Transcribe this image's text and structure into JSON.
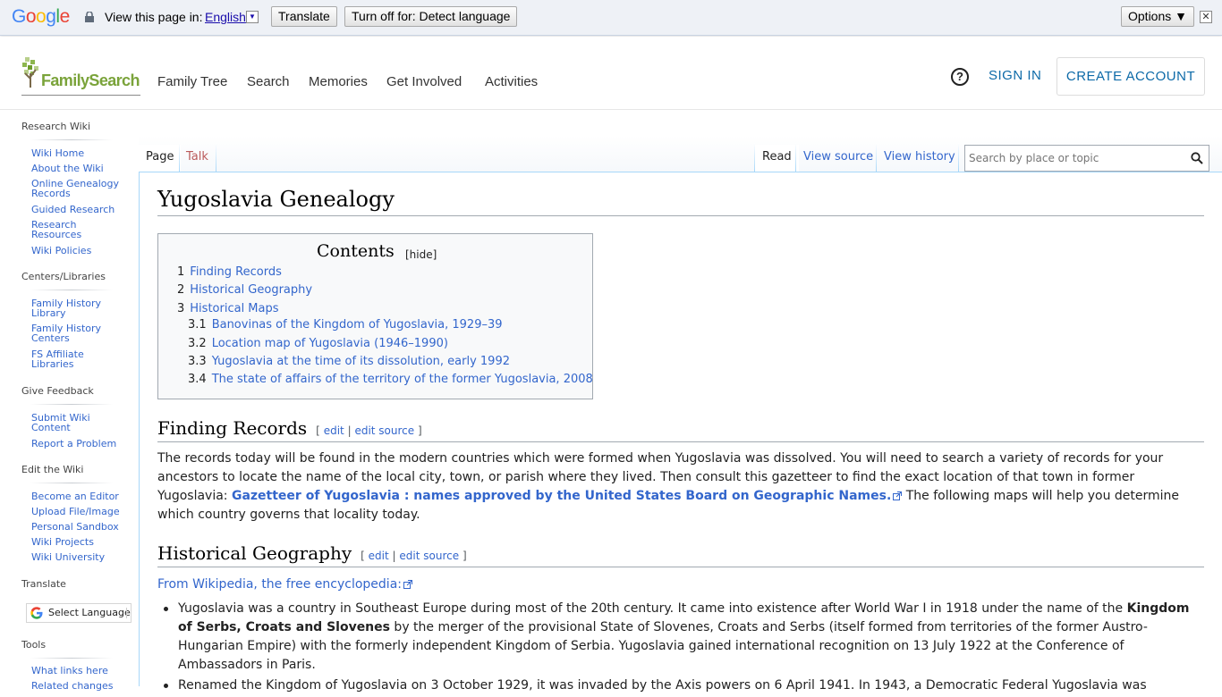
{
  "translate_bar": {
    "logo": "Google",
    "view_text": "View this page in:",
    "language": "English",
    "translate_label": "Translate",
    "turn_off_label": "Turn off for: Detect language",
    "options_label": "Options ▼",
    "close_label": "✕"
  },
  "header": {
    "logo_text": "FamilySearch",
    "nav": [
      "Family Tree",
      "Search",
      "Memories",
      "Get Involved",
      "Activities"
    ],
    "help": "?",
    "sign_in": "SIGN IN",
    "create_account": "CREATE ACCOUNT"
  },
  "sidebar": {
    "sections": [
      {
        "heading": "Research Wiki",
        "links": [
          "Wiki Home",
          "About the Wiki",
          "Online Genealogy Records",
          "Guided Research",
          "Research Resources",
          "Wiki Policies"
        ]
      },
      {
        "heading": "Centers/Libraries",
        "links": [
          "Family History Library",
          "Family History Centers",
          "FS Affiliate Libraries"
        ]
      },
      {
        "heading": "Give Feedback",
        "links": [
          "Submit Wiki Content",
          "Report a Problem"
        ]
      },
      {
        "heading": "Edit the Wiki",
        "links": [
          "Become an Editor",
          "Upload File/Image",
          "Personal Sandbox",
          "Wiki Projects",
          "Wiki University"
        ]
      },
      {
        "heading": "Translate",
        "select_language": "Select Language"
      },
      {
        "heading": "Tools",
        "links": [
          "What links here",
          "Related changes"
        ]
      }
    ]
  },
  "tabs": {
    "left": [
      "Page",
      "Talk"
    ],
    "right": [
      "Read",
      "View source",
      "View history"
    ],
    "search_placeholder": "Search by place or topic"
  },
  "article": {
    "title": "Yugoslavia Genealogy",
    "toc": {
      "title": "Contents",
      "hide": "[hide]",
      "items": [
        {
          "num": "1",
          "label": "Finding Records"
        },
        {
          "num": "2",
          "label": "Historical Geography"
        },
        {
          "num": "3",
          "label": "Historical Maps"
        },
        {
          "num": "3.1",
          "label": "Banovinas of the Kingdom of Yugoslavia, 1929–39"
        },
        {
          "num": "3.2",
          "label": "Location map of Yugoslavia (1946–1990)"
        },
        {
          "num": "3.3",
          "label": "Yugoslavia at the time of its dissolution, early 1992"
        },
        {
          "num": "3.4",
          "label": "The state of affairs of the territory of the former Yugoslavia, 2008"
        }
      ]
    },
    "edit_open": "[",
    "edit_label": "edit",
    "edit_sep": "|",
    "edit_source_label": "edit source",
    "edit_close": "]",
    "section1": {
      "heading": "Finding Records",
      "text_a": "The records today will be found in the modern countries which were formed when Yugoslavia was dissolved. You will need to search a variety of records for your ancestors to locate the name of the local city, town, or parish where they lived. Then consult this gazetteer to find the exact location of that town in former Yugoslavia: ",
      "link": "Gazetteer of Yugoslavia : names approved by the United States Board on Geographic Names.",
      "text_b": " The following maps will help you determine which country governs that locality today."
    },
    "section2": {
      "heading": "Historical Geography",
      "source_link": "From Wikipedia, the free encyclopedia:",
      "bullet1_a": "Yugoslavia was a country in Southeast Europe during most of the 20th century. It came into existence after World War I in 1918 under the name of the ",
      "bullet1_bold": "Kingdom of Serbs, Croats and Slovenes",
      "bullet1_b": " by the merger of the provisional State of Slovenes, Croats and Serbs (itself formed from territories of the former Austro-Hungarian Empire) with the formerly independent Kingdom of Serbia. Yugoslavia gained international recognition on 13 July 1922 at the Conference of Ambassadors in Paris.",
      "bullet2": "Renamed the Kingdom of Yugoslavia on 3 October 1929, it was invaded by the Axis powers on 6 April 1941. In 1943, a Democratic Federal Yugoslavia was"
    }
  }
}
